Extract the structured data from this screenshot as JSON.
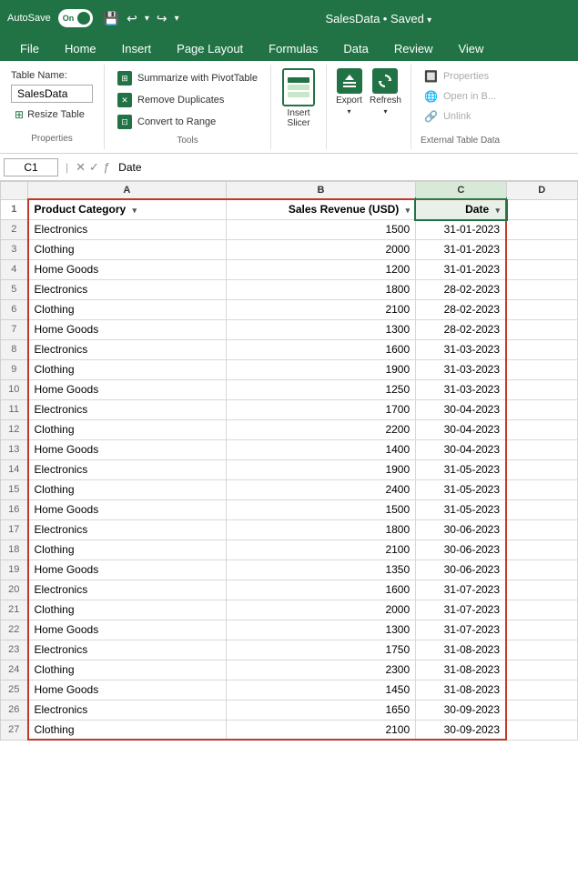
{
  "titlebar": {
    "autosave": "AutoSave",
    "on": "On",
    "filename": "SalesData",
    "saved": "Saved",
    "undo_icon": "↩",
    "redo_icon": "↪"
  },
  "ribbon": {
    "tabs": [
      "File",
      "Home",
      "Insert",
      "Page Layout",
      "Formulas",
      "Data",
      "Review",
      "View"
    ],
    "active_tab": "Table Design",
    "groups": {
      "properties": {
        "label": "Properties",
        "table_name_label": "Table Name:",
        "table_name_value": "SalesData",
        "resize_label": "Resize Table"
      },
      "tools": {
        "label": "Tools",
        "summarize": "Summarize with PivotTable",
        "remove_dupes": "Remove Duplicates",
        "convert": "Convert to Range"
      },
      "insert_slicer": {
        "label": "Insert Slicer"
      },
      "export": {
        "label": "",
        "export_label": "Export",
        "refresh_label": "Refresh"
      },
      "external": {
        "label": "External Table Data",
        "properties": "Properties",
        "open_in_b": "Open in B...",
        "unlink": "Unlink"
      }
    }
  },
  "formulabar": {
    "cell_ref": "C1",
    "formula": "Date"
  },
  "columns": {
    "row_header": "",
    "a": "A",
    "b": "B",
    "c": "C",
    "d": "D"
  },
  "headers": {
    "a": "Product Category",
    "b": "Sales Revenue (USD)",
    "c": "Date"
  },
  "rows": [
    {
      "row": 2,
      "a": "Electronics",
      "b": "1500",
      "c": "31-01-2023"
    },
    {
      "row": 3,
      "a": "Clothing",
      "b": "2000",
      "c": "31-01-2023"
    },
    {
      "row": 4,
      "a": "Home Goods",
      "b": "1200",
      "c": "31-01-2023"
    },
    {
      "row": 5,
      "a": "Electronics",
      "b": "1800",
      "c": "28-02-2023"
    },
    {
      "row": 6,
      "a": "Clothing",
      "b": "2100",
      "c": "28-02-2023"
    },
    {
      "row": 7,
      "a": "Home Goods",
      "b": "1300",
      "c": "28-02-2023"
    },
    {
      "row": 8,
      "a": "Electronics",
      "b": "1600",
      "c": "31-03-2023"
    },
    {
      "row": 9,
      "a": "Clothing",
      "b": "1900",
      "c": "31-03-2023"
    },
    {
      "row": 10,
      "a": "Home Goods",
      "b": "1250",
      "c": "31-03-2023"
    },
    {
      "row": 11,
      "a": "Electronics",
      "b": "1700",
      "c": "30-04-2023"
    },
    {
      "row": 12,
      "a": "Clothing",
      "b": "2200",
      "c": "30-04-2023"
    },
    {
      "row": 13,
      "a": "Home Goods",
      "b": "1400",
      "c": "30-04-2023"
    },
    {
      "row": 14,
      "a": "Electronics",
      "b": "1900",
      "c": "31-05-2023"
    },
    {
      "row": 15,
      "a": "Clothing",
      "b": "2400",
      "c": "31-05-2023"
    },
    {
      "row": 16,
      "a": "Home Goods",
      "b": "1500",
      "c": "31-05-2023"
    },
    {
      "row": 17,
      "a": "Electronics",
      "b": "1800",
      "c": "30-06-2023"
    },
    {
      "row": 18,
      "a": "Clothing",
      "b": "2100",
      "c": "30-06-2023"
    },
    {
      "row": 19,
      "a": "Home Goods",
      "b": "1350",
      "c": "30-06-2023"
    },
    {
      "row": 20,
      "a": "Electronics",
      "b": "1600",
      "c": "31-07-2023"
    },
    {
      "row": 21,
      "a": "Clothing",
      "b": "2000",
      "c": "31-07-2023"
    },
    {
      "row": 22,
      "a": "Home Goods",
      "b": "1300",
      "c": "31-07-2023"
    },
    {
      "row": 23,
      "a": "Electronics",
      "b": "1750",
      "c": "31-08-2023"
    },
    {
      "row": 24,
      "a": "Clothing",
      "b": "2300",
      "c": "31-08-2023"
    },
    {
      "row": 25,
      "a": "Home Goods",
      "b": "1450",
      "c": "31-08-2023"
    },
    {
      "row": 26,
      "a": "Electronics",
      "b": "1650",
      "c": "30-09-2023"
    },
    {
      "row": 27,
      "a": "Clothing",
      "b": "2100",
      "c": "30-09-2023"
    }
  ]
}
